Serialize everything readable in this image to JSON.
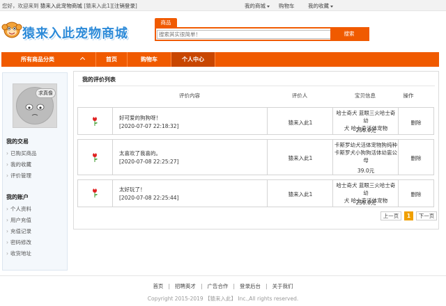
{
  "topbar": {
    "welcome_prefix": "您好，欢迎来到",
    "site_name": "猿来入此宠物商城",
    "user_bracket": "[猿来入此1][",
    "logout": "注销登录",
    "close_bracket": "]",
    "my_mall": "我的商城",
    "cart": "购物车",
    "favorites": "我的收藏"
  },
  "header": {
    "logo_text": "猿来入此宠物商城",
    "search_tab": "商品",
    "search_placeholder": "搜索其实很简单！",
    "search_button": "搜索"
  },
  "nav": {
    "categories": "所有商品分类",
    "items": [
      "首页",
      "购物车",
      "个人中心"
    ]
  },
  "sidebar": {
    "avatar_bubble": "求真像",
    "trade_title": "我的交易",
    "trade_items": [
      "已购买商品",
      "我的收藏",
      "评价管理"
    ],
    "account_title": "我的账户",
    "account_items": [
      "个人资料",
      "用户充值",
      "充值记录",
      "密码修改",
      "收货地址"
    ]
  },
  "main": {
    "title": "我的评价列表",
    "headers": [
      "评价内容",
      "评价人",
      "宝贝信息",
      "操作"
    ],
    "rows": [
      {
        "comment": "好可爱的狗狗呀！",
        "time": "[2020-07-07 22:18:32]",
        "reviewer": "猿来入此1",
        "product_lines": [
          "哈士奇犬 蓝眼三火哈士奇幼",
          "犬 哈士奇活体宠物"
        ],
        "price": "256.0元",
        "op": "删除"
      },
      {
        "comment": "太喜欢了我喜的。",
        "time": "[2020-07-08 22:25:27]",
        "reviewer": "猿来入此1",
        "product_lines": [
          "卡斯罗幼犬活体宠物狗纯种",
          "卡斯罗犬小狗狗活体幼崽公",
          "母"
        ],
        "price": "39.0元",
        "op": "删除"
      },
      {
        "comment": "太好玩了！",
        "time": "[2020-07-08 22:25:44]",
        "reviewer": "猿来入此1",
        "product_lines": [
          "哈士奇犬 蓝眼三火哈士奇幼",
          "犬 哈士奇活体宠物"
        ],
        "price": "256.0元",
        "op": "删除"
      }
    ]
  },
  "pagination": {
    "prev": "上一页",
    "current": "1",
    "next": "下一页"
  },
  "footer": {
    "links": [
      "首页",
      "招聘英才",
      "广告合作",
      "登录后台",
      "关于我们"
    ],
    "separator": "|",
    "copyright": "Copyright 2015-2019 【猿来入此】 Inc.,All rights reserved."
  },
  "colors": {
    "brand_orange": "#f05a00",
    "nav_active": "#c84600",
    "page_current": "#f0a000",
    "logo_blue": "#2c8ad8"
  },
  "icons": [
    "flower-icon",
    "chevron-up-icon",
    "caret-down-icon",
    "avatar-icon",
    "mascot-logo-icon"
  ]
}
